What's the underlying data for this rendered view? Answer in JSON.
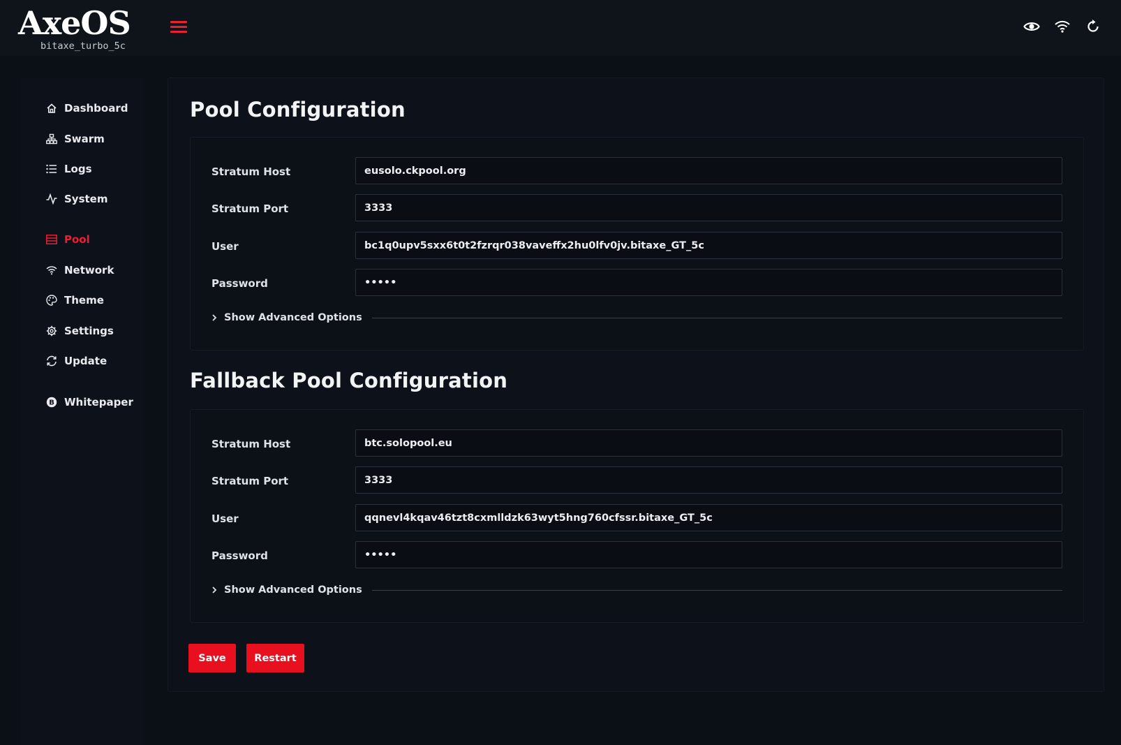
{
  "header": {
    "logo_text": "AxeOS",
    "device_name": "bitaxe_turbo_5c",
    "menu_icon": "hamburger-menu-icon",
    "actions": [
      {
        "icon": "eye-icon"
      },
      {
        "icon": "wifi-icon"
      },
      {
        "icon": "refresh-icon"
      }
    ]
  },
  "sidebar": {
    "items": [
      {
        "label": "Dashboard",
        "icon": "home-icon"
      },
      {
        "label": "Swarm",
        "icon": "sitemap-icon"
      },
      {
        "label": "Logs",
        "icon": "list-icon"
      },
      {
        "label": "System",
        "icon": "pulse-icon"
      },
      {
        "label": "Pool",
        "icon": "server-icon",
        "active": true
      },
      {
        "label": "Network",
        "icon": "wifi-icon"
      },
      {
        "label": "Theme",
        "icon": "palette-icon"
      },
      {
        "label": "Settings",
        "icon": "gear-icon"
      },
      {
        "label": "Update",
        "icon": "sync-icon"
      },
      {
        "label": "Whitepaper",
        "icon": "bitcoin-icon"
      }
    ]
  },
  "pool": {
    "title": "Pool Configuration",
    "fields": [
      {
        "label": "Stratum Host",
        "value": "eusolo.ckpool.org"
      },
      {
        "label": "Stratum Port",
        "value": "3333"
      },
      {
        "label": "User",
        "value": "bc1q0upv5sxx6t0t2fzrqr038vaveffx2hu0lfv0jv.bitaxe_GT_5c"
      },
      {
        "label": "Password",
        "value": "•••••"
      }
    ],
    "advanced_label": "Show Advanced Options"
  },
  "fallback": {
    "title": "Fallback Pool Configuration",
    "fields": [
      {
        "label": "Stratum Host",
        "value": "btc.solopool.eu"
      },
      {
        "label": "Stratum Port",
        "value": "3333"
      },
      {
        "label": "User",
        "value": "qqnevl4kqav46tzt8cxmlldzk63wyt5hng760cfssr.bitaxe_GT_5c"
      },
      {
        "label": "Password",
        "value": "•••••"
      }
    ],
    "advanced_label": "Show Advanced Options"
  },
  "actions": {
    "save_label": "Save",
    "restart_label": "Restart"
  },
  "colors": {
    "accent": "#e8202f",
    "background": "#0b0f16",
    "panel": "#0d121a"
  }
}
